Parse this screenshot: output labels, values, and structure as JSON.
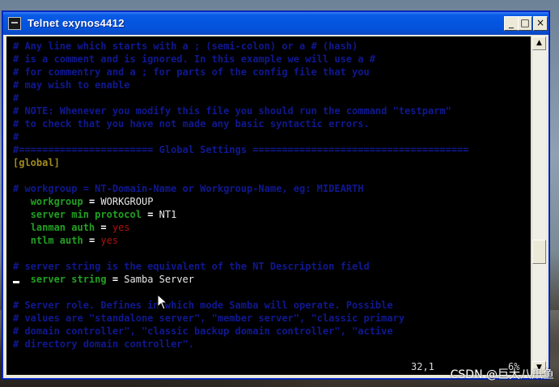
{
  "window": {
    "title": "Telnet exynos4412",
    "buttons": {
      "minimize": "_",
      "maximize": "□",
      "close": "×"
    },
    "icon": "terminal-icon"
  },
  "terminal": {
    "lines": [
      {
        "text": "# Any line which starts with a ; (semi-colon) or a # (hash)",
        "kind": "comment"
      },
      {
        "text": "# is a comment and is ignored. In this example we will use a #",
        "kind": "comment"
      },
      {
        "text": "# for commentry and a ; for parts of the config file that you",
        "kind": "comment"
      },
      {
        "text": "# may wish to enable",
        "kind": "comment"
      },
      {
        "text": "#",
        "kind": "comment"
      },
      {
        "text": "# NOTE: Whenever you modify this file you should run the command \"testparm\"",
        "kind": "comment"
      },
      {
        "text": "# to check that you have not made any basic syntactic errors.",
        "kind": "comment"
      },
      {
        "text": "#",
        "kind": "comment"
      },
      {
        "text": "#======================= Global Settings =====================================",
        "kind": "comment"
      },
      {
        "text": "[global]",
        "kind": "section"
      },
      {
        "text": "",
        "kind": "blank"
      },
      {
        "text": "# workgroup = NT-Domain-Name or Workgroup-Name, eg: MIDEARTH",
        "kind": "comment"
      },
      {
        "key": "workgroup",
        "eq": " = ",
        "value": "WORKGROUP",
        "value_color": "white",
        "kind": "setting"
      },
      {
        "key": "server min protocol",
        "eq": " = ",
        "value": "NT1",
        "value_color": "white",
        "kind": "setting"
      },
      {
        "key": "lanman auth",
        "eq": " = ",
        "value": "yes",
        "value_color": "red",
        "kind": "setting"
      },
      {
        "key": "ntlm auth",
        "eq": " = ",
        "value": "yes",
        "value_color": "red",
        "kind": "setting"
      },
      {
        "text": "",
        "kind": "blank"
      },
      {
        "text": "# server string is the equivalent of the NT Description field",
        "kind": "comment"
      },
      {
        "key": "server string",
        "eq": " = ",
        "value": "Samba Server",
        "value_color": "white",
        "kind": "setting"
      },
      {
        "text": "",
        "kind": "blank"
      },
      {
        "text": "# Server role. Defines in which mode Samba will operate. Possible",
        "kind": "comment"
      },
      {
        "text": "# values are \"standalone server\", \"member server\", \"classic primary",
        "kind": "comment"
      },
      {
        "text": "# domain controller\", \"classic backup domain controller\", \"active",
        "kind": "comment"
      },
      {
        "text": "# directory domain controller\".",
        "kind": "comment"
      }
    ],
    "status": {
      "position": "32,1",
      "percent": "6%"
    }
  },
  "watermark": "CSDN @巨大八爪鱼",
  "colors": {
    "comment": "#101890",
    "section": "#a08c1e",
    "key": "#22a022",
    "red_value": "#b01010",
    "titlebar": "#0454e0"
  }
}
